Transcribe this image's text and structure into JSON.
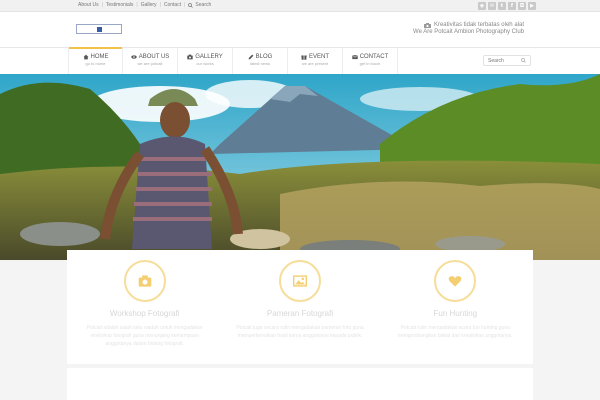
{
  "topbar": {
    "links": [
      "About Us",
      "Testimonials",
      "Gallery",
      "Contact"
    ],
    "search_label": "Search",
    "socials": [
      "rss-icon",
      "email-icon",
      "twitter-icon",
      "facebook-icon",
      "instagram-icon",
      "youtube-icon"
    ]
  },
  "header": {
    "tagline_line1": "Kreativitas tidak terbatas oleh alat",
    "tagline_line2": "We Are Potcait Ambion Photography Club"
  },
  "nav": {
    "items": [
      {
        "label": "Home",
        "sub": "go to home",
        "icon": "home-icon"
      },
      {
        "label": "About Us",
        "sub": "we are potcait",
        "icon": "eye-icon"
      },
      {
        "label": "Gallery",
        "sub": "our works",
        "icon": "camera-icon"
      },
      {
        "label": "Blog",
        "sub": "latest news",
        "icon": "pencil-icon"
      },
      {
        "label": "Event",
        "sub": "we are present",
        "icon": "gift-icon"
      },
      {
        "label": "Contact",
        "sub": "get in touch",
        "icon": "envelope-icon"
      }
    ],
    "search_placeholder": "Search"
  },
  "features": [
    {
      "title": "Workshop Fotografi",
      "desc": "Potcait adalah salah satu wadah untuk mengadakan workshop fotografi guna menunjang kemampuan anggotanya dalam bidang fotografi.",
      "icon": "camera-icon"
    },
    {
      "title": "Pameran Fotografi",
      "desc": "Potcait juga secara rutin mengadakan pameran foto guna memperkenalkan hasil karya anggotanya kepada publik.",
      "icon": "image-icon"
    },
    {
      "title": "Fun Hunting",
      "desc": "Potcait rutin mengadakan acara fun hunting guna mengembangkan bakat dan kreativitas anggotanya.",
      "icon": "heart-icon"
    }
  ],
  "colors": {
    "accent": "#f0c24b",
    "icon_ring": "#f6dd9a"
  }
}
